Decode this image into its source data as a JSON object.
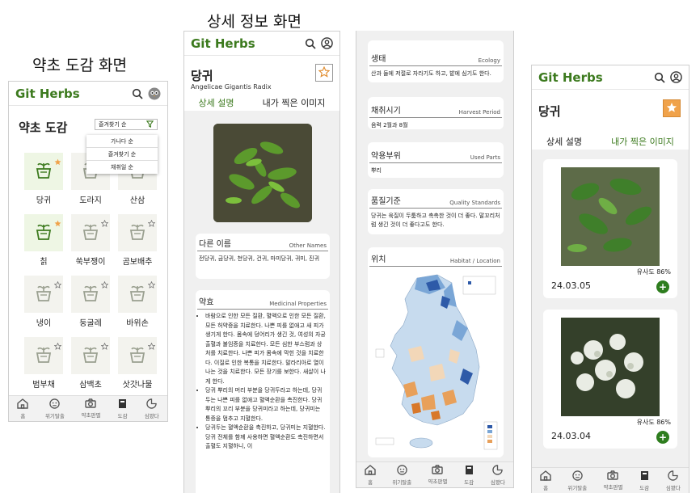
{
  "captions": {
    "catalog": "약초 도감 화면",
    "detail": "상세 정보 화면"
  },
  "app": {
    "brand": "Git Herbs"
  },
  "icons": {
    "search": "search-icon",
    "profile": "user-circle-icon",
    "avatar": "owl-avatar-icon",
    "filter": "funnel-icon",
    "star": "star-icon",
    "plus": "plus-icon"
  },
  "colors": {
    "brand": "#3c7a1e",
    "star": "#f0a24a",
    "tile": "#eef6e4"
  },
  "nav": [
    {
      "label": "홈",
      "icon": "home-icon"
    },
    {
      "label": "위기탈출",
      "icon": "face-icon"
    },
    {
      "label": "약초판별",
      "icon": "camera-icon"
    },
    {
      "label": "도감",
      "icon": "book-icon"
    },
    {
      "label": "심봤다",
      "icon": "pacman-icon"
    }
  ],
  "catalog": {
    "title": "약초 도감",
    "sort_label": "즐겨찾기 순",
    "sort_options": [
      "가나다 순",
      "즐겨찾기 순",
      "채취일 순"
    ],
    "herbs": [
      {
        "name": "당귀",
        "fav": true
      },
      {
        "name": "도라지",
        "fav": false
      },
      {
        "name": "산삼",
        "fav": false
      },
      {
        "name": "칡",
        "fav": true
      },
      {
        "name": "쑥부쟁이",
        "fav": false
      },
      {
        "name": "곰보배추",
        "fav": false
      },
      {
        "name": "냉이",
        "fav": false
      },
      {
        "name": "둥굴레",
        "fav": false
      },
      {
        "name": "바위손",
        "fav": false
      },
      {
        "name": "범부채",
        "fav": false
      },
      {
        "name": "삼백초",
        "fav": false
      },
      {
        "name": "삿갓나물",
        "fav": false
      }
    ]
  },
  "detail": {
    "name": "당귀",
    "latin": "Angelicae Gigantis Radix",
    "tabs": [
      "상세 설명",
      "내가 찍은 이미지"
    ],
    "other_names": {
      "title": "다른 이름",
      "en": "Other Names",
      "text": "전당귀, 금당귀, 천당귀, 건귀, 마미당귀, 귀미, 진귀"
    },
    "properties": {
      "title": "약효",
      "en": "Medicinal Properties",
      "items": [
        "바람으로 인한 모든 질환, 혈액으로 인한 모든 질환, 모든 허약증을 치료한다. 나쁜 피를 없애고 새 피가 생기게 한다. 몸속에 덩어리가 생긴 것, 여성의 자궁출혈과 불임증을 치료한다. 모든 심한 부스럼과 상처를 치료한다. 나쁜 피가 몸속에 막힌 것을 치료한다. 이질로 인한 복통을 치료한다. 말라리아로 열이 나는 것을 치료한다. 모든 장기를 보한다. 새살이 나게 한다.",
        "당귀 뿌리의 머리 부분을 당귀두라고 하는데, 당귀두는 나쁜 피를 없애고 혈액순환을 촉진한다. 당귀 뿌리의 꼬리 부분을 당귀미라고 하는데, 당귀미는 통증을 멈추고 지혈한다.",
        "당귀두는 혈액순환을 촉진하고, 당귀미는 지혈한다. 당귀 전체를 함께 사용하면 혈액순환도 촉진하면서 출혈도 지혈하니, 이"
      ]
    },
    "ecology": {
      "title": "생태",
      "en": "Ecology",
      "text": "산과 들에 저절로 자라기도 하고, 밭에 심기도 한다."
    },
    "harvest": {
      "title": "채취시기",
      "en": "Harvest Period",
      "text": "음력 2월과 8월"
    },
    "parts": {
      "title": "약용부위",
      "en": "Used Parts",
      "text": "뿌리"
    },
    "quality": {
      "title": "품질기준",
      "en": "Quality Standards",
      "text": "당귀는 육질이 두툼하고 촉촉한 것이 더 좋다. 말꼬리처럼 생긴 것이 더 좋다고도 한다."
    },
    "habitat": {
      "title": "위치",
      "en": "Habitat / Location"
    }
  },
  "my_images": {
    "name": "당귀",
    "tabs": [
      "상세 설명",
      "내가 찍은 이미지"
    ],
    "photos": [
      {
        "similarity": "유사도 86%",
        "date": "24.03.05"
      },
      {
        "similarity": "유사도 86%",
        "date": "24.03.04"
      }
    ]
  }
}
